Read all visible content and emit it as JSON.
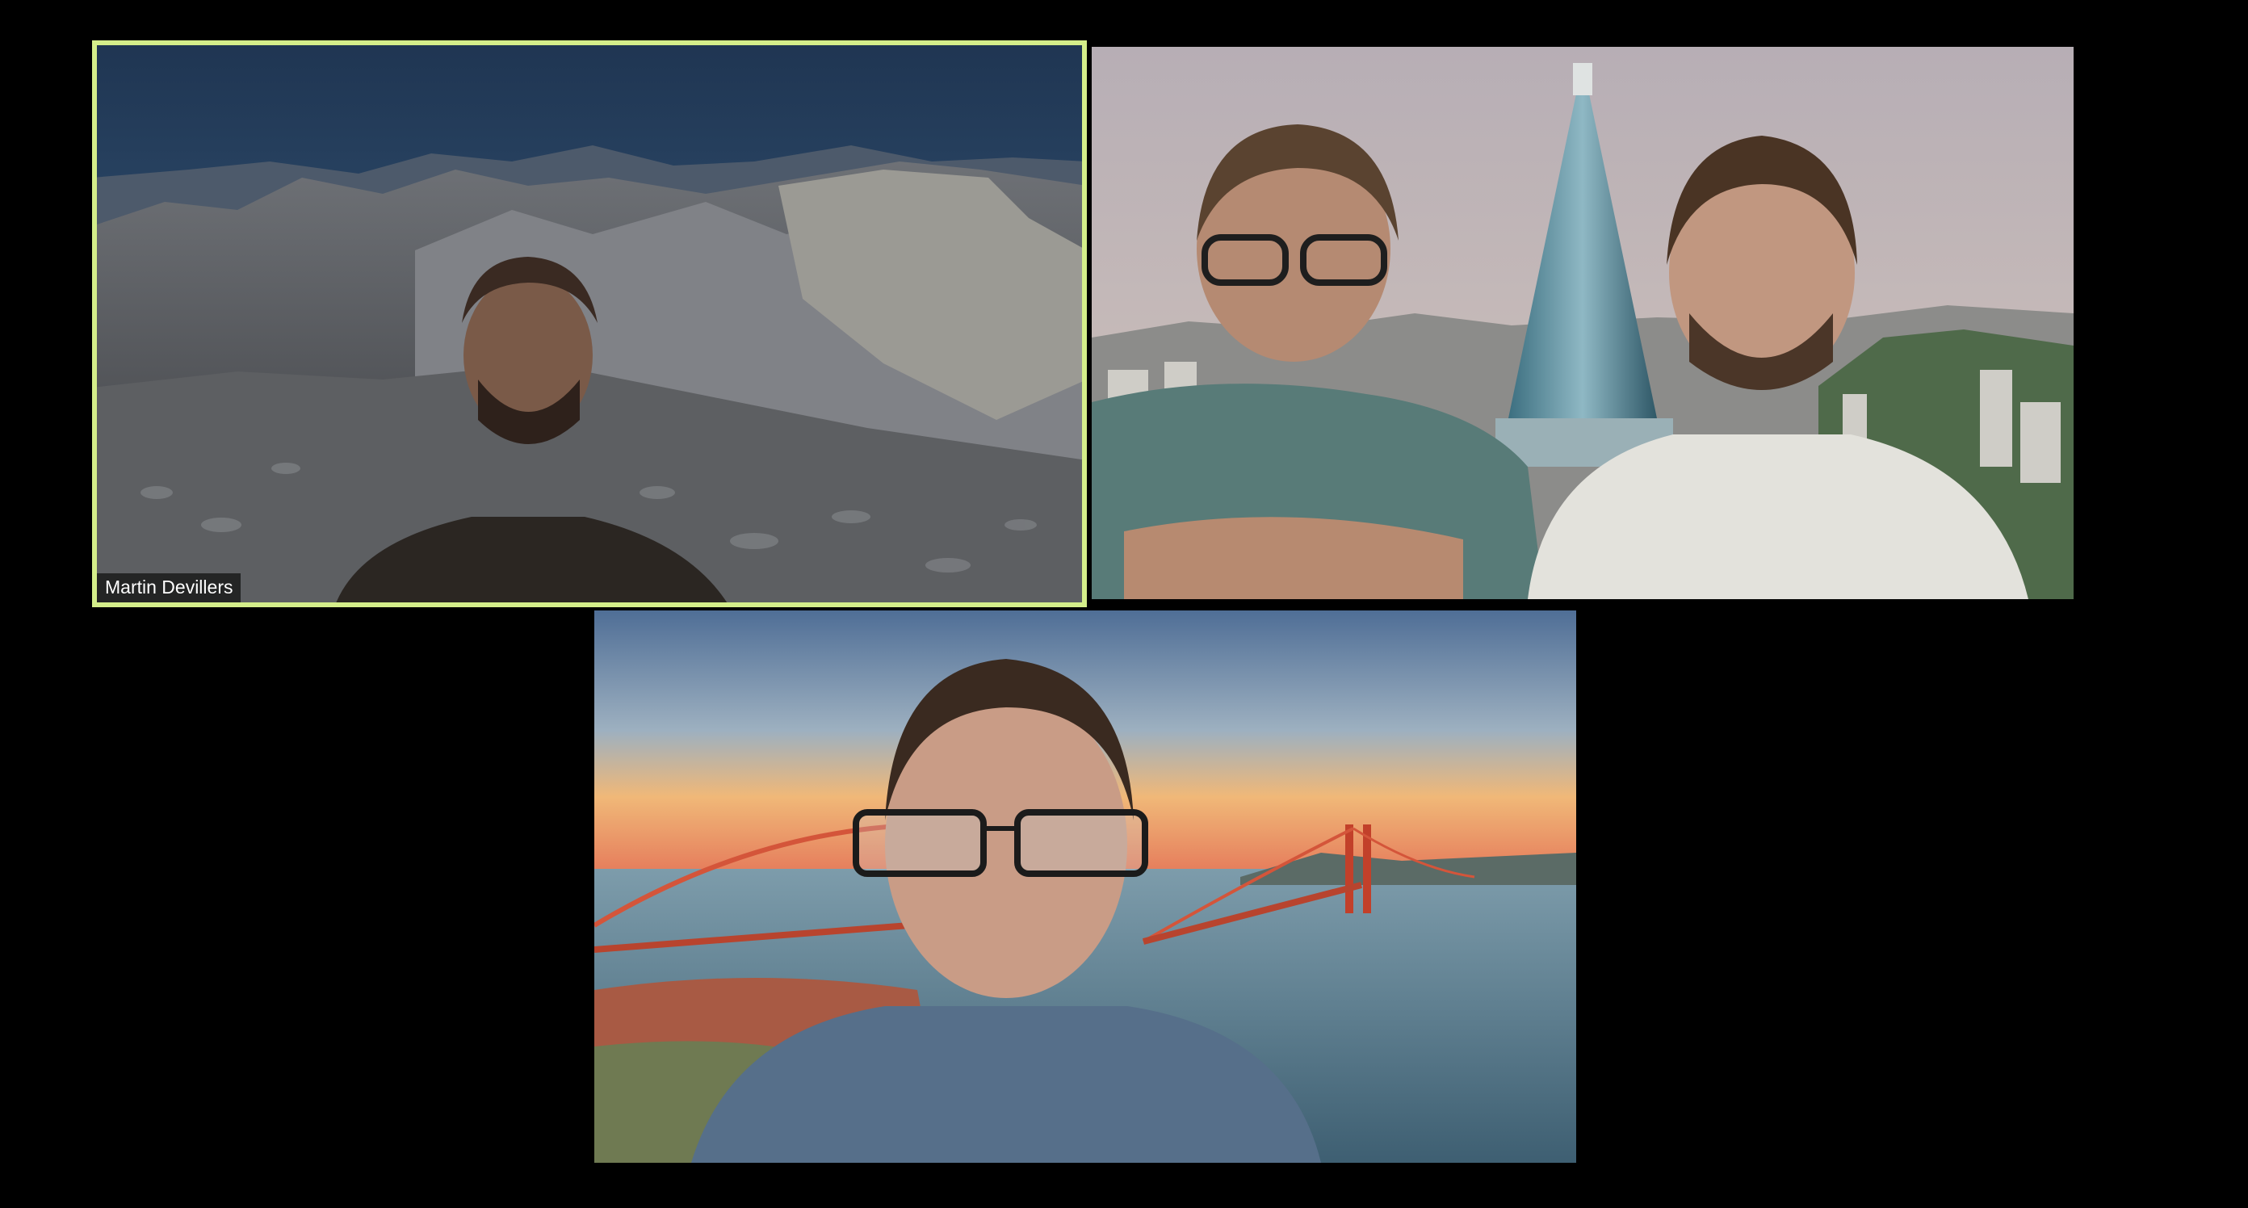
{
  "meeting": {
    "layout": "gallery",
    "background_color": "#000000",
    "active_speaker_border_color": "#d4ee8a"
  },
  "participants": [
    {
      "name": "Martin Devillers",
      "active_speaker": true,
      "virtual_background": "mountain-ridge"
    },
    {
      "name": "",
      "active_speaker": false,
      "virtual_background": "city-skyline-pyramid-tower"
    },
    {
      "name": "",
      "active_speaker": false,
      "virtual_background": "golden-gate-bridge-sunset"
    }
  ]
}
